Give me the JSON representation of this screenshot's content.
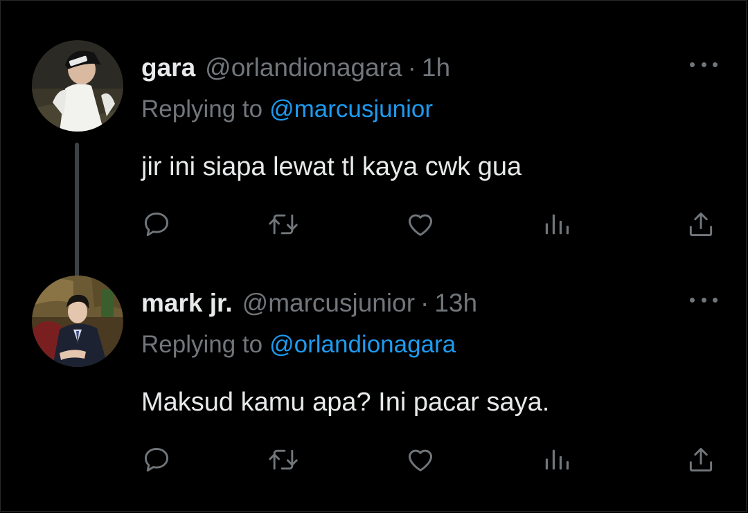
{
  "tweets": [
    {
      "display_name": "gara",
      "handle": "@orlandionagara",
      "separator": "·",
      "time": "1h",
      "replying_label": "Replying to",
      "replying_to": "@marcusjunior",
      "text": "jir ini siapa lewat tl kaya cwk gua",
      "avatar_icon": "avatar-photo",
      "actions": [
        "reply-icon",
        "retweet-icon",
        "like-icon",
        "views-icon",
        "share-icon"
      ]
    },
    {
      "display_name": "mark jr.",
      "handle": "@marcusjunior",
      "separator": "·",
      "time": "13h",
      "replying_label": "Replying to",
      "replying_to": "@orlandionagara",
      "text": "Maksud kamu apa? Ini pacar saya.",
      "avatar_icon": "avatar-photo",
      "actions": [
        "reply-icon",
        "retweet-icon",
        "like-icon",
        "views-icon",
        "share-icon"
      ]
    }
  ],
  "colors": {
    "background": "#000000",
    "primary_text": "#e7e9ea",
    "secondary_text": "#71767b",
    "link": "#1d9bf0",
    "thread_line": "#3d4145"
  }
}
